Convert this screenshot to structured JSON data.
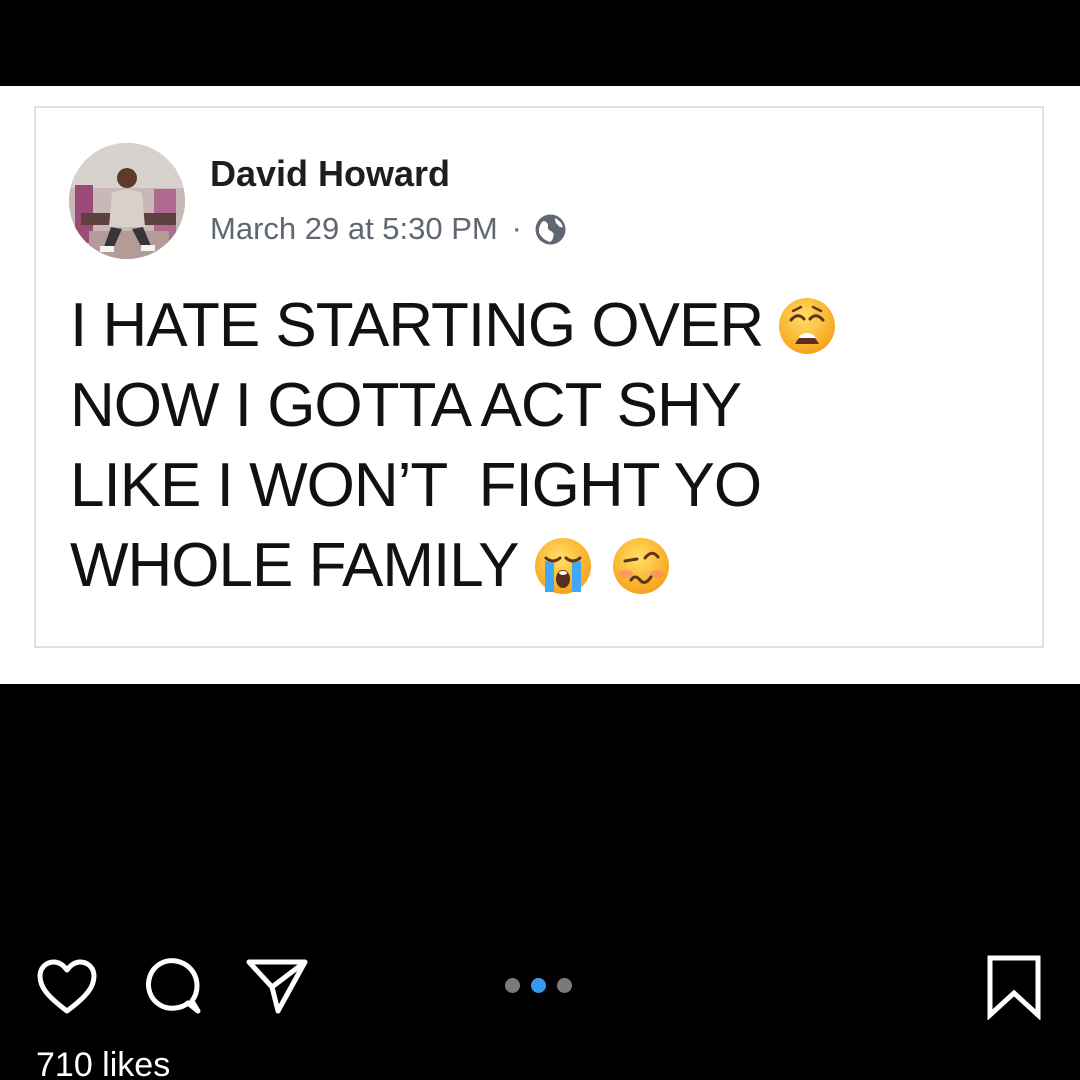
{
  "post": {
    "author_name": "David Howard",
    "timestamp": "March 29 at 5:30 PM",
    "separator": "·",
    "privacy_icon": "globe-icon",
    "text_lines": [
      {
        "text": "I HATE STARTING OVER",
        "emojis": [
          "weary-face-emoji"
        ]
      },
      {
        "text": "NOW I GOTTA ACT SHY",
        "emojis": []
      },
      {
        "text": "LIKE I WON’T  FIGHT YO",
        "emojis": []
      },
      {
        "text": "WHOLE FAMILY",
        "emojis": [
          "loudly-crying-face-emoji",
          "woozy-face-emoji"
        ]
      }
    ]
  },
  "actions": {
    "icons": [
      "heart-icon",
      "comment-icon",
      "share-icon",
      "bookmark-icon"
    ],
    "carousel": {
      "count": 3,
      "active_index": 1
    },
    "likes": "710 likes"
  },
  "colors": {
    "background": "#000000",
    "card": "#ffffff",
    "author_text": "#1c1e21",
    "meta_text": "#606770",
    "active_dot": "#3897f0",
    "inactive_dot": "#7a7a7a"
  }
}
